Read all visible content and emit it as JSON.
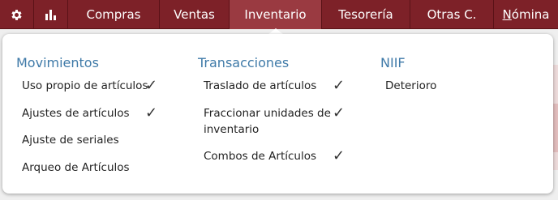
{
  "nav": {
    "settings_icon": "gear-icon",
    "reports_icon": "bar-chart-icon",
    "items": [
      "Compras",
      "Ventas",
      "Inventario",
      "Tesorería",
      "Otras C.",
      "Nómina"
    ],
    "nomina_first": "N",
    "nomina_rest": "ómina",
    "active": "Inventario"
  },
  "menu": {
    "movimientos": {
      "title": "Movimientos",
      "items": [
        {
          "label": "Uso propio de artículos",
          "checked": true
        },
        {
          "label": "Ajustes de artículos",
          "checked": true
        },
        {
          "label": "Ajuste de seriales",
          "checked": false
        },
        {
          "label": "Arqueo de Artículos",
          "checked": false
        }
      ]
    },
    "transacciones": {
      "title": "Transacciones",
      "items": [
        {
          "label": "Traslado de artículos",
          "checked": true
        },
        {
          "label_line1": "Fraccionar unidades de",
          "label_line2": "inventario",
          "checked": true
        },
        {
          "label": "Combos de Artículos",
          "checked": true
        }
      ]
    },
    "niif": {
      "title": "NIIF",
      "items": [
        {
          "label": "Deterioro",
          "checked": false
        }
      ]
    },
    "check_glyph": "✓"
  },
  "colors": {
    "nav_bg": "#7d2128",
    "nav_active": "#9a3a41",
    "section_title": "#3f7aa8"
  }
}
